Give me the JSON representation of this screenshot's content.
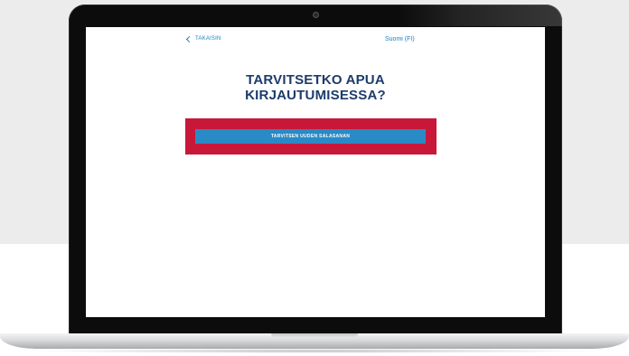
{
  "nav": {
    "back_label": "TAKAISIN",
    "language_label": "Suomi (FI)"
  },
  "main": {
    "title_line1": "TARVITSETKO APUA",
    "title_line2": "KIRJAUTUMISESSA?",
    "new_password_button": "TARVITSEN UUDEN SALASANAN"
  },
  "colors": {
    "accent_blue": "#2a8ac6",
    "title_navy": "#1d3b6b",
    "highlight_red": "#c8183a",
    "link_blue": "#1a7fc1"
  },
  "icons": {
    "back": "chevron-left-icon"
  }
}
